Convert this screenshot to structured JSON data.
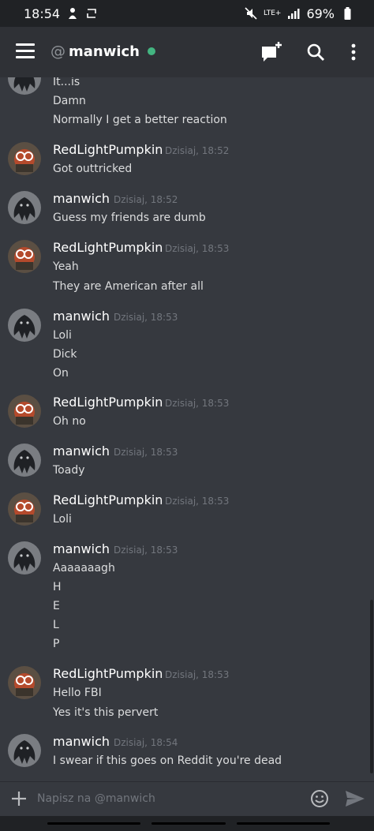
{
  "status_bar": {
    "time": "18:54",
    "signal_label": "LTE+",
    "battery": "69%"
  },
  "header": {
    "at_symbol": "@",
    "username": "manwich",
    "online_color": "#43b581",
    "icons": [
      "menu-icon",
      "new-group-dm-icon",
      "search-icon",
      "more-vert-icon"
    ]
  },
  "messages": [
    {
      "author": "",
      "timestamp": "",
      "lines": [
        "It...is",
        "Damn",
        "Normally I get a better reaction"
      ]
    },
    {
      "author": "RedLightPumpkin",
      "timestamp": "Dzisiaj, 18:52",
      "lines": [
        "Got outtricked"
      ]
    },
    {
      "author": "manwich",
      "timestamp": "Dzisiaj, 18:52",
      "lines": [
        "Guess my friends are dumb"
      ]
    },
    {
      "author": "RedLightPumpkin",
      "timestamp": "Dzisiaj, 18:53",
      "lines": [
        "Yeah",
        "They are American after all"
      ]
    },
    {
      "author": "manwich",
      "timestamp": "Dzisiaj, 18:53",
      "lines": [
        "Loli",
        "Dick",
        "On"
      ]
    },
    {
      "author": "RedLightPumpkin",
      "timestamp": "Dzisiaj, 18:53",
      "lines": [
        "Oh no"
      ]
    },
    {
      "author": "manwich",
      "timestamp": "Dzisiaj, 18:53",
      "lines": [
        "Toady"
      ]
    },
    {
      "author": "RedLightPumpkin",
      "timestamp": "Dzisiaj, 18:53",
      "lines": [
        "Loli"
      ]
    },
    {
      "author": "manwich",
      "timestamp": "Dzisiaj, 18:53",
      "lines": [
        "Aaaaaaagh",
        "H",
        "E",
        "L",
        "P"
      ]
    },
    {
      "author": "RedLightPumpkin",
      "timestamp": "Dzisiaj, 18:53",
      "lines": [
        "Hello FBI",
        "Yes it's this pervert"
      ]
    },
    {
      "author": "manwich",
      "timestamp": "Dzisiaj, 18:54",
      "lines": [
        "I swear if this goes on Reddit you're dead"
      ]
    }
  ],
  "composer": {
    "placeholder": "Napisz na @manwich"
  }
}
